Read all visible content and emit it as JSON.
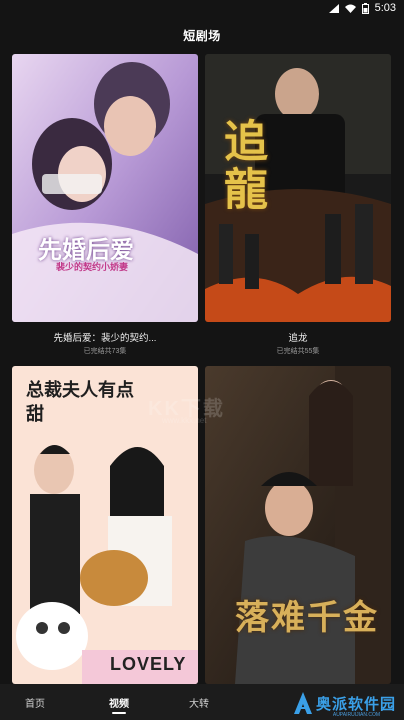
{
  "status_bar": {
    "time": "5:03"
  },
  "header": {
    "title": "短剧场"
  },
  "dramas": [
    {
      "title": "先婚后爱：裴少的契约...",
      "episodes": "已完结共73集",
      "poster_title": "先婚后爱",
      "poster_subtitle": "裴少的契约小娇妻"
    },
    {
      "title": "追龙",
      "episodes": "已完结共55集",
      "poster_title": "追龍"
    },
    {
      "title": "",
      "episodes": "",
      "poster_title": "总裁夫人有点甜",
      "poster_tag": "LOVELY"
    },
    {
      "title": "",
      "episodes": "",
      "poster_title": "落难千金"
    }
  ],
  "tabs": [
    {
      "label": "首页"
    },
    {
      "label": "视频"
    },
    {
      "label": "大转"
    }
  ],
  "watermarks": {
    "center": "KK下载",
    "center_url": "www.kkx.net",
    "corner": "奥派软件园",
    "corner_url": "AUPAIRUIJIAN.COM"
  }
}
